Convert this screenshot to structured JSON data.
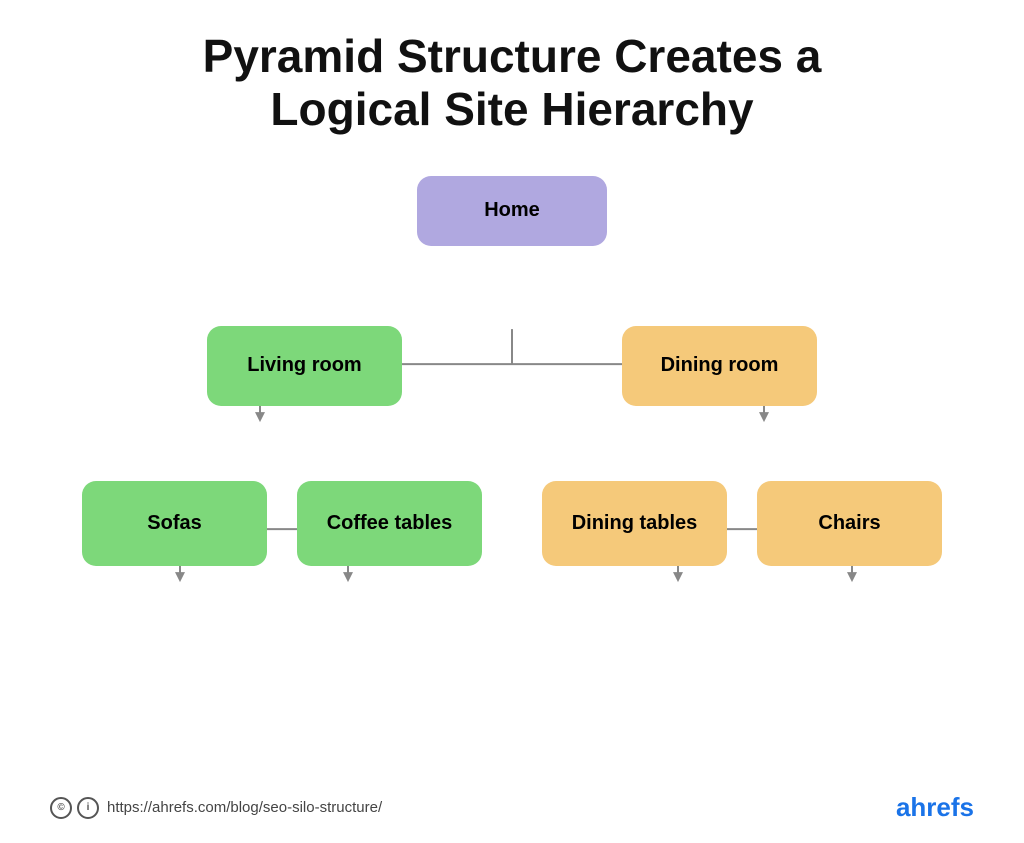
{
  "title": {
    "line1": "Pyramid Structure Creates a",
    "line2": "Logical Site Hierarchy"
  },
  "nodes": {
    "home": "Home",
    "living_room": "Living room",
    "dining_room": "Dining room",
    "sofas": "Sofas",
    "coffee_tables": "Coffee tables",
    "dining_tables": "Dining tables",
    "chairs": "Chairs"
  },
  "footer": {
    "url": "https://ahrefs.com/blog/seo-silo-structure/",
    "brand": "ahrefs"
  },
  "colors": {
    "home": "#b0a8e0",
    "green": "#7dd87a",
    "orange": "#f5c97a",
    "connector": "#888888"
  }
}
